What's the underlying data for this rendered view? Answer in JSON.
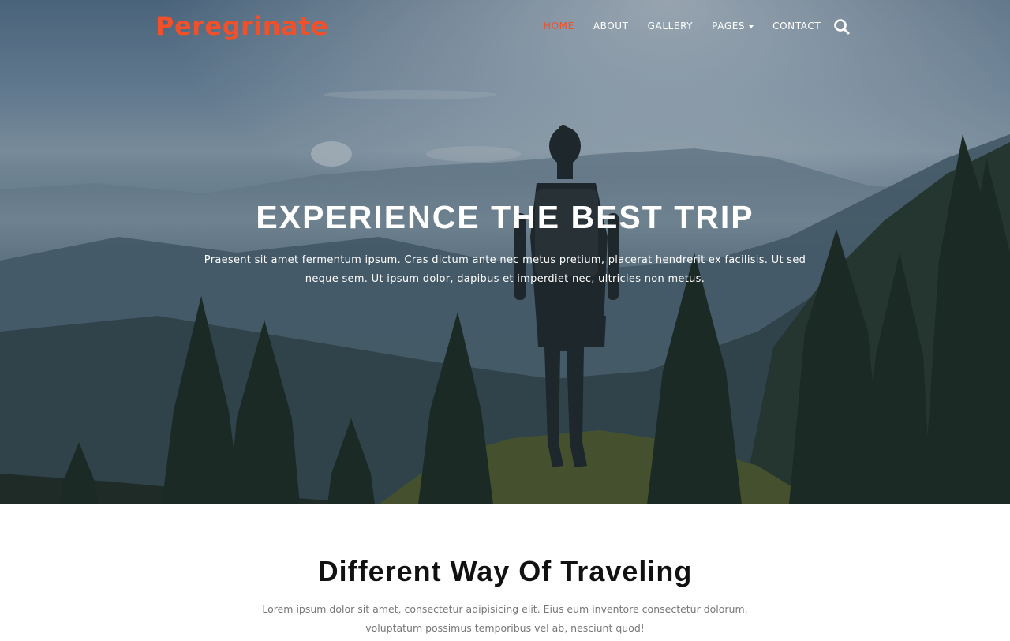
{
  "brand": {
    "name": "Peregrinate",
    "accent_color": "#f0502a"
  },
  "nav": {
    "items": [
      {
        "label": "HOME",
        "active": true
      },
      {
        "label": "ABOUT"
      },
      {
        "label": "GALLERY"
      },
      {
        "label": "PAGES",
        "dropdown": true
      },
      {
        "label": "CONTACT"
      }
    ],
    "search_icon": "search-icon"
  },
  "hero": {
    "title": "EXPERIENCE THE BEST TRIP",
    "text": "Praesent sit amet fermentum ipsum. Cras dictum ante nec metus pretium, placerat hendrerit ex facilisis. Ut sed neque sem. Ut ipsum dolor, dapibus et imperdiet nec, ultricies non metus."
  },
  "section": {
    "title": "Different Way Of Traveling",
    "text": "Lorem ipsum dolor sit amet, consectetur adipisicing elit. Eius eum inventore consectetur dolorum, voluptatum possimus temporibus vel ab, nesciunt quod!"
  }
}
